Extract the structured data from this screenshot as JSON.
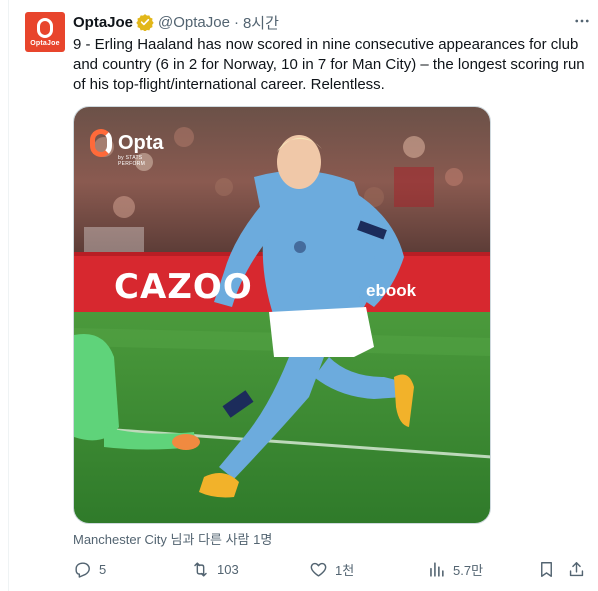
{
  "author": {
    "name": "OptaJoe",
    "handle": "@OptaJoe",
    "separator": "·",
    "time": "8시간",
    "avatar_text": "OptaJoe",
    "avatar_color": "#e8452c",
    "verified_color": "#e2b719"
  },
  "tweet": {
    "text": "9 - Erling Haaland has now scored in nine consecutive appearances for club and country (6 in 2 for Norway, 10 in 7 for Man City) – the longest scoring run of his top-flight/international career. Relentless."
  },
  "media": {
    "watermark_brand": "Opta",
    "watermark_sub": "by STATS PERFORM",
    "ad_board_text": "CAZOO",
    "ad_board_text_2": "ebook",
    "pitch_color": "#3f8d36",
    "kit_color": "#6cabdd"
  },
  "social_context": "Manchester City 님과 다른 사람 1명",
  "actions": {
    "reply": {
      "icon": "reply-icon",
      "count": "5"
    },
    "retweet": {
      "icon": "retweet-icon",
      "count": "103"
    },
    "like": {
      "icon": "heart-icon",
      "count": "1천"
    },
    "views": {
      "icon": "views-icon",
      "count": "5.7만"
    },
    "bookmark": {
      "icon": "bookmark-icon"
    },
    "share": {
      "icon": "share-icon"
    }
  },
  "more_icon": "more-icon"
}
